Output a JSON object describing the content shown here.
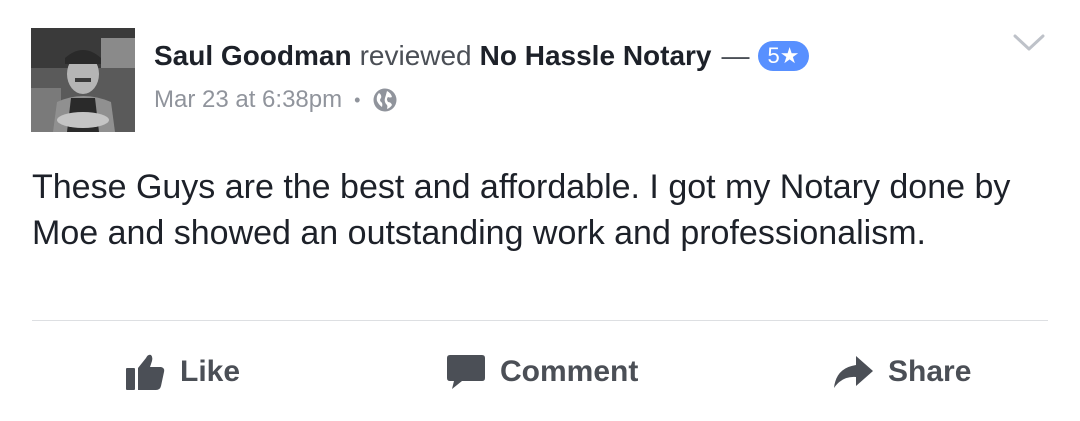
{
  "post": {
    "author": "Saul Goodman",
    "action": "reviewed",
    "page": "No Hassle Notary",
    "separator": "—",
    "rating_badge": "5★",
    "timestamp": "Mar 23 at 6:38pm",
    "meta_separator": "•",
    "privacy_icon": "globe-icon",
    "menu_icon": "chevron-down-icon",
    "text": "These Guys are the best and affordable. I got my Notary done by Moe and showed an outstanding work and professionalism."
  },
  "actions": {
    "like_label": "Like",
    "comment_label": "Comment",
    "share_label": "Share"
  },
  "colors": {
    "badge": "#5890ff",
    "text": "#1d2129",
    "muted": "#90949c",
    "action": "#4b4f56",
    "divider": "#dddfe2"
  }
}
